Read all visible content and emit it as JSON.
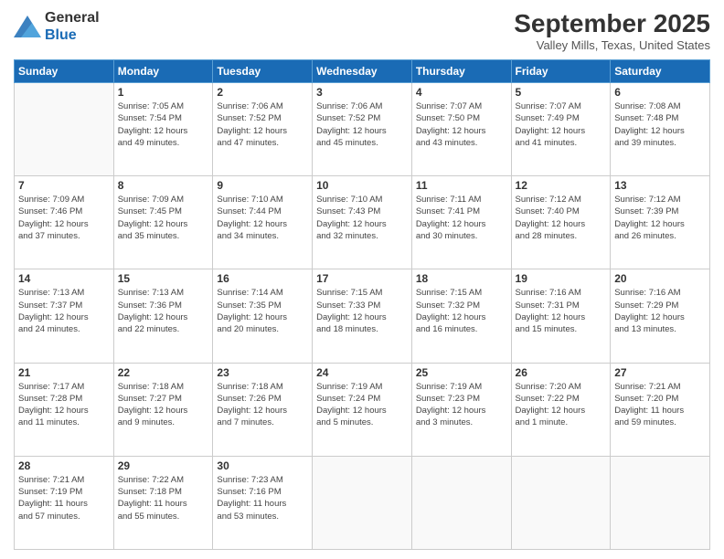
{
  "logo": {
    "line1": "General",
    "line2": "Blue"
  },
  "title": "September 2025",
  "location": "Valley Mills, Texas, United States",
  "headers": [
    "Sunday",
    "Monday",
    "Tuesday",
    "Wednesday",
    "Thursday",
    "Friday",
    "Saturday"
  ],
  "weeks": [
    [
      {
        "day": "",
        "info": ""
      },
      {
        "day": "1",
        "info": "Sunrise: 7:05 AM\nSunset: 7:54 PM\nDaylight: 12 hours\nand 49 minutes."
      },
      {
        "day": "2",
        "info": "Sunrise: 7:06 AM\nSunset: 7:52 PM\nDaylight: 12 hours\nand 47 minutes."
      },
      {
        "day": "3",
        "info": "Sunrise: 7:06 AM\nSunset: 7:52 PM\nDaylight: 12 hours\nand 45 minutes."
      },
      {
        "day": "4",
        "info": "Sunrise: 7:07 AM\nSunset: 7:50 PM\nDaylight: 12 hours\nand 43 minutes."
      },
      {
        "day": "5",
        "info": "Sunrise: 7:07 AM\nSunset: 7:49 PM\nDaylight: 12 hours\nand 41 minutes."
      },
      {
        "day": "6",
        "info": "Sunrise: 7:08 AM\nSunset: 7:48 PM\nDaylight: 12 hours\nand 39 minutes."
      }
    ],
    [
      {
        "day": "7",
        "info": "Sunrise: 7:09 AM\nSunset: 7:46 PM\nDaylight: 12 hours\nand 37 minutes."
      },
      {
        "day": "8",
        "info": "Sunrise: 7:09 AM\nSunset: 7:45 PM\nDaylight: 12 hours\nand 35 minutes."
      },
      {
        "day": "9",
        "info": "Sunrise: 7:10 AM\nSunset: 7:44 PM\nDaylight: 12 hours\nand 34 minutes."
      },
      {
        "day": "10",
        "info": "Sunrise: 7:10 AM\nSunset: 7:43 PM\nDaylight: 12 hours\nand 32 minutes."
      },
      {
        "day": "11",
        "info": "Sunrise: 7:11 AM\nSunset: 7:41 PM\nDaylight: 12 hours\nand 30 minutes."
      },
      {
        "day": "12",
        "info": "Sunrise: 7:12 AM\nSunset: 7:40 PM\nDaylight: 12 hours\nand 28 minutes."
      },
      {
        "day": "13",
        "info": "Sunrise: 7:12 AM\nSunset: 7:39 PM\nDaylight: 12 hours\nand 26 minutes."
      }
    ],
    [
      {
        "day": "14",
        "info": "Sunrise: 7:13 AM\nSunset: 7:37 PM\nDaylight: 12 hours\nand 24 minutes."
      },
      {
        "day": "15",
        "info": "Sunrise: 7:13 AM\nSunset: 7:36 PM\nDaylight: 12 hours\nand 22 minutes."
      },
      {
        "day": "16",
        "info": "Sunrise: 7:14 AM\nSunset: 7:35 PM\nDaylight: 12 hours\nand 20 minutes."
      },
      {
        "day": "17",
        "info": "Sunrise: 7:15 AM\nSunset: 7:33 PM\nDaylight: 12 hours\nand 18 minutes."
      },
      {
        "day": "18",
        "info": "Sunrise: 7:15 AM\nSunset: 7:32 PM\nDaylight: 12 hours\nand 16 minutes."
      },
      {
        "day": "19",
        "info": "Sunrise: 7:16 AM\nSunset: 7:31 PM\nDaylight: 12 hours\nand 15 minutes."
      },
      {
        "day": "20",
        "info": "Sunrise: 7:16 AM\nSunset: 7:29 PM\nDaylight: 12 hours\nand 13 minutes."
      }
    ],
    [
      {
        "day": "21",
        "info": "Sunrise: 7:17 AM\nSunset: 7:28 PM\nDaylight: 12 hours\nand 11 minutes."
      },
      {
        "day": "22",
        "info": "Sunrise: 7:18 AM\nSunset: 7:27 PM\nDaylight: 12 hours\nand 9 minutes."
      },
      {
        "day": "23",
        "info": "Sunrise: 7:18 AM\nSunset: 7:26 PM\nDaylight: 12 hours\nand 7 minutes."
      },
      {
        "day": "24",
        "info": "Sunrise: 7:19 AM\nSunset: 7:24 PM\nDaylight: 12 hours\nand 5 minutes."
      },
      {
        "day": "25",
        "info": "Sunrise: 7:19 AM\nSunset: 7:23 PM\nDaylight: 12 hours\nand 3 minutes."
      },
      {
        "day": "26",
        "info": "Sunrise: 7:20 AM\nSunset: 7:22 PM\nDaylight: 12 hours\nand 1 minute."
      },
      {
        "day": "27",
        "info": "Sunrise: 7:21 AM\nSunset: 7:20 PM\nDaylight: 11 hours\nand 59 minutes."
      }
    ],
    [
      {
        "day": "28",
        "info": "Sunrise: 7:21 AM\nSunset: 7:19 PM\nDaylight: 11 hours\nand 57 minutes."
      },
      {
        "day": "29",
        "info": "Sunrise: 7:22 AM\nSunset: 7:18 PM\nDaylight: 11 hours\nand 55 minutes."
      },
      {
        "day": "30",
        "info": "Sunrise: 7:23 AM\nSunset: 7:16 PM\nDaylight: 11 hours\nand 53 minutes."
      },
      {
        "day": "",
        "info": ""
      },
      {
        "day": "",
        "info": ""
      },
      {
        "day": "",
        "info": ""
      },
      {
        "day": "",
        "info": ""
      }
    ]
  ]
}
